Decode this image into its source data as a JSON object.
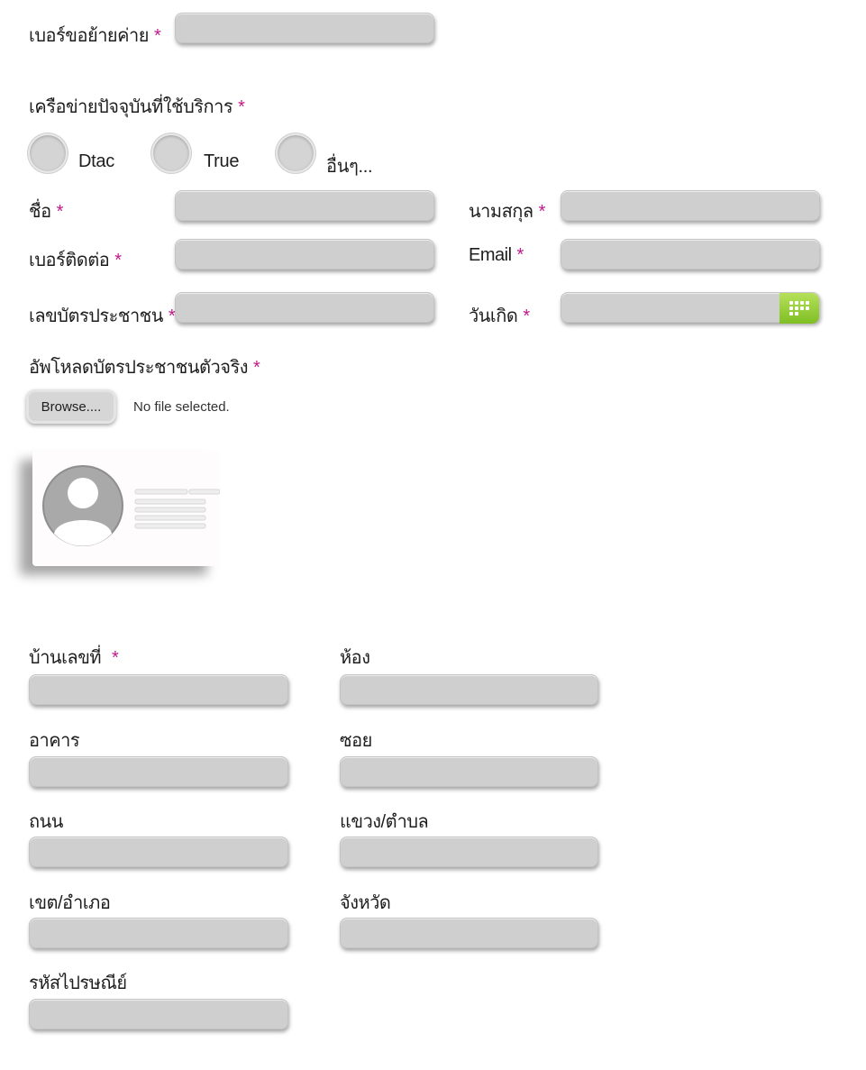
{
  "port_number": {
    "label": "เบอร์ขอย้ายค่าย",
    "required": "*",
    "value": ""
  },
  "current_network": {
    "label": "เครือข่ายปัจจุบันที่ใช้บริการ",
    "required": "*",
    "options": [
      "Dtac",
      "True",
      "อื่นๆ..."
    ]
  },
  "first_name": {
    "label": "ชื่อ",
    "required": "*",
    "value": ""
  },
  "last_name": {
    "label": "นามสกุล",
    "required": "*",
    "value": ""
  },
  "contact_number": {
    "label": "เบอร์ติดต่อ",
    "required": "*",
    "value": ""
  },
  "email": {
    "label": "Email",
    "required": "*",
    "value": ""
  },
  "id_card_number": {
    "label": "เลขบัตรประชาชน",
    "required": "*",
    "value": ""
  },
  "birth_date": {
    "label": "วันเกิด",
    "required": "*",
    "value": "",
    "icon": "calendar-icon"
  },
  "upload": {
    "label": "อัพโหลดบัตรประชาชนตัวจริง",
    "required": "*",
    "button_label": "Browse....",
    "status": "No file selected.",
    "preview_icon": "id-card-icon"
  },
  "address": {
    "house_no": {
      "label": "บ้านเลขที่",
      "required": "*",
      "value": ""
    },
    "room": {
      "label": "ห้อง",
      "value": ""
    },
    "building": {
      "label": "อาคาร",
      "value": ""
    },
    "soi": {
      "label": "ซอย",
      "value": ""
    },
    "road": {
      "label": "ถนน",
      "value": ""
    },
    "subdistrict": {
      "label": "แขวง/ตำบล",
      "value": ""
    },
    "district": {
      "label": "เขต/อำเภอ",
      "value": ""
    },
    "province": {
      "label": "จังหวัด",
      "value": ""
    },
    "postcode": {
      "label": "รหัสไปรษณีย์",
      "value": ""
    }
  },
  "colors": {
    "required_mark": "#c0188a",
    "field_bg": "#cfcfcf",
    "calendar_button": "#8cc63f"
  }
}
